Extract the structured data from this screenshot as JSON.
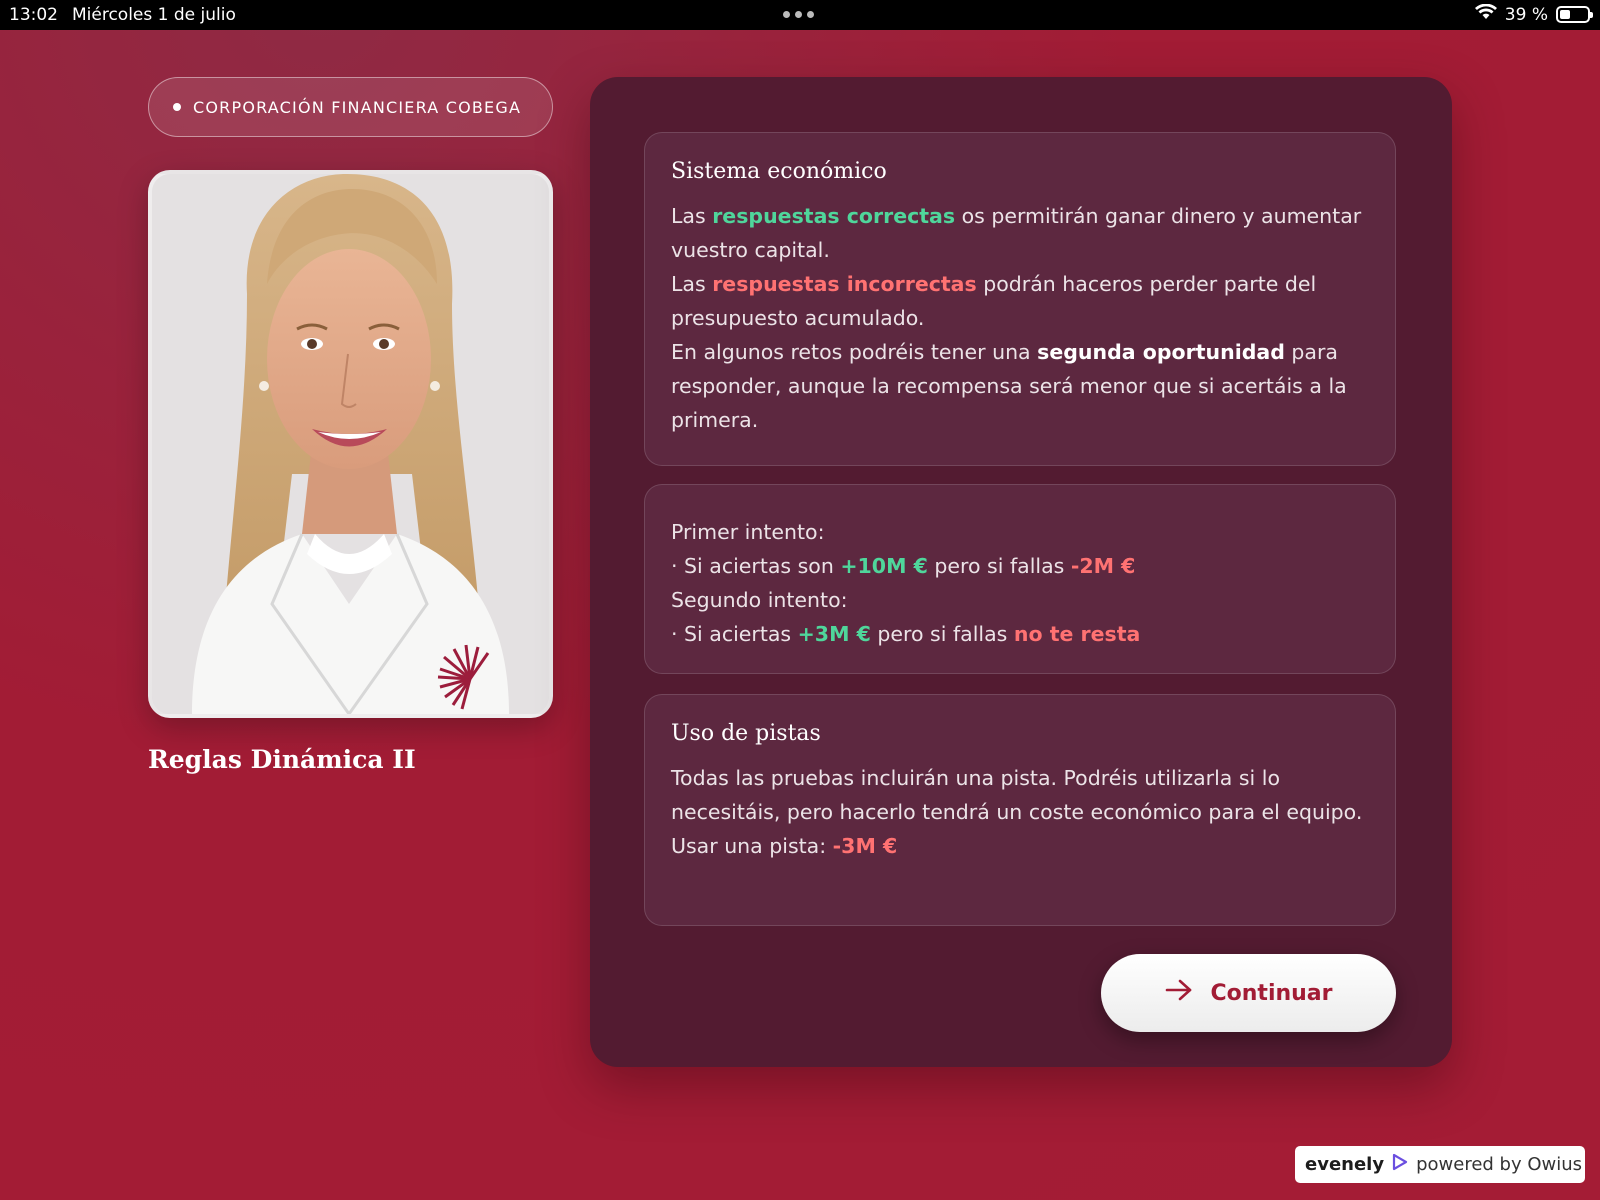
{
  "status_bar": {
    "time": "13:02",
    "date": "Miércoles 1 de julio",
    "battery": "39 %",
    "battery_level": 0.39
  },
  "company": {
    "name": "CORPORACIÓN FINANCIERA COBEGA"
  },
  "page": {
    "title": "Reglas Dinámica II"
  },
  "sections": {
    "economic": {
      "title": "Sistema económico",
      "p1_pre": "Las ",
      "p1_highlight": "respuestas correctas",
      "p1_post": " os permitirán ganar dinero y aumentar vuestro capital.",
      "p2_pre": "Las ",
      "p2_highlight": "respuestas incorrectas",
      "p2_post": " podrán haceros perder parte del presupuesto acumulado.",
      "p3_pre": "En algunos retos podréis tener una ",
      "p3_highlight": "segunda oportunidad",
      "p3_post": " para responder, aunque la recompensa será menor que si acertáis a la primera."
    },
    "attempts": {
      "first_label": "Primer intento:",
      "first_pre": "· Si aciertas son ",
      "first_gain": "+10M €",
      "first_mid": " pero si fallas ",
      "first_loss": "-2M €",
      "second_label": "Segundo intento:",
      "second_pre": "· Si aciertas ",
      "second_gain": "+3M €",
      "second_mid": " pero si fallas ",
      "second_loss": "no te resta"
    },
    "hints": {
      "title": "Uso de pistas",
      "body": "Todas las pruebas incluirán una pista. Podréis utilizarla si lo necesitáis, pero hacerlo tendrá un coste económico para el equipo.",
      "cost_label": "Usar una pista: ",
      "cost_value": "-3M €"
    }
  },
  "actions": {
    "continue_label": "Continuar"
  },
  "footer": {
    "brand": "evenely",
    "powered": "powered by Owius"
  },
  "colors": {
    "background": "#a21c35",
    "panel": "#531b31",
    "card": "#5d2840",
    "positive": "#4fd69b",
    "negative": "#ff7272"
  }
}
